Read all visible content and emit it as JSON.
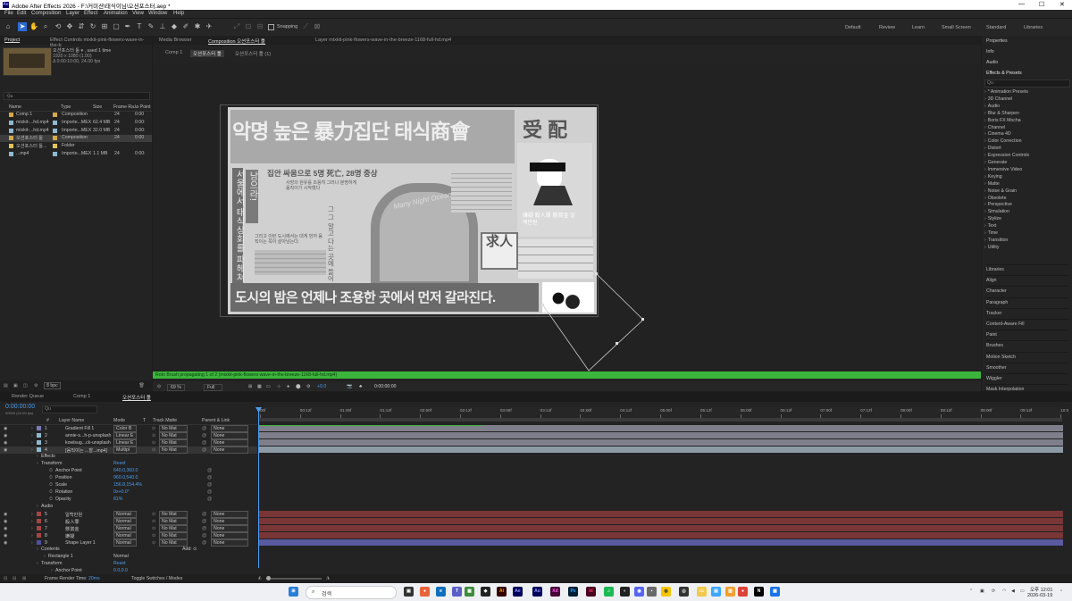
{
  "title_bar": {
    "title": "Adobe After Effects 2026 - F:\\커미션\\태식이님\\오션포스터.aep *",
    "logo_text": "Ae"
  },
  "menu": [
    "File",
    "Edit",
    "Composition",
    "Layer",
    "Effect",
    "Animation",
    "View",
    "Window",
    "Help"
  ],
  "toolbar": {
    "snapping_label": "Snapping"
  },
  "workspaces": [
    "Default",
    "Review",
    "Learn",
    "Small Screen",
    "Standard",
    "Libraries"
  ],
  "project_panel": {
    "tab_project": "Project",
    "tab_effect_controls": "Effect Controls mixkit-pink-flowers-wave-in-the-b",
    "item_name": "오션포스터 툴 ▾ , used 1 time",
    "item_dims": "1920 x 1080 (1.00)",
    "item_dur": "Δ 0:00:10:00, 24.00 fps",
    "search_placeholder": "Ⓠ▸",
    "columns": [
      "Name",
      "Type",
      "Size",
      "Frame Ra...",
      "In Point"
    ],
    "rows": [
      {
        "name": "Comp 1",
        "type": "Composition",
        "size": "",
        "fps": "24",
        "in": "0:00",
        "color": "#d4a94a"
      },
      {
        "name": "mixkit-...hd.mp4",
        "type": "Importe...MEX",
        "size": "62.4 MB",
        "fps": "24",
        "in": "0:00:",
        "color": "#8fb8d0"
      },
      {
        "name": "mixkit-...hd.mp4",
        "type": "Importe...MEX",
        "size": "32.0 MB",
        "fps": "24",
        "in": "0:00:",
        "color": "#8fb8d0"
      },
      {
        "name": "오션포스터 툴",
        "type": "Composition",
        "size": "",
        "fps": "24",
        "in": "0:00",
        "color": "#d4a94a"
      },
      {
        "name": "오션포스터 툴...",
        "type": "Folder",
        "size": "",
        "fps": "",
        "in": "",
        "color": "#e2c35a"
      },
      {
        "name": "...mp4",
        "type": "Importe...MEX",
        "size": "1.1 MB",
        "fps": "24",
        "in": "0:00:",
        "color": "#8fb8d0"
      }
    ],
    "bpc": "8 bpc"
  },
  "viewer": {
    "tabs": [
      "Media Browser",
      "Composition 오션포스터 툴",
      "Layer mixkit-pink-flowers-wave-in-the-breeze-1168-full-hd.mp4"
    ],
    "breadcrumbs": [
      "Comp 1",
      "오션포스터 툴",
      "오션포스터 툴 (1)"
    ],
    "status": "Roto Brush propagating 1 of 2 (mixkit-pink-flowers-wave-in-the-breeze-1168-full-hd.mp4)",
    "zoom": "69 %",
    "quality": "Full",
    "exposure": "+0.0",
    "timecode": "0:00:00:00"
  },
  "poster": {
    "headline": "악명 높은 暴力집단 태식商會",
    "side_title": "受 配",
    "vertical_left": "서울에서 태식상회를 파헤쳐",
    "vertical_mid": "남으라!",
    "story_title": "집안 싸움으로 5명 死亡, 28명 중상",
    "story_sub": "사망의 원유를 조용히 그러나 분명하게 움직이기 시작했다",
    "wanted_big": "求人",
    "wanted_text": "嫌疑 殺人罪 懸賞金 일백만원",
    "col_text": "그 그 알고 다는 곳에 들어 있었다",
    "mid_text": "그리고 이런 도시에서는 대게 먼저 움직이는 쪽이 살아남는다.",
    "bottom": "도시의 밤은 언제나 조용한 곳에서 먼저 갈라진다.",
    "watermark": "Many Night Ocean"
  },
  "right_panel": {
    "top_items": [
      "Properties",
      "Info",
      "Audio",
      "Effects & Presets"
    ],
    "search": "Qu",
    "effects": [
      "* Animation Presets",
      "3D Channel",
      "Audio",
      "Blur & Sharpen",
      "Boris FX Mocha",
      "Channel",
      "Cinema 4D",
      "Color Correction",
      "Distort",
      "Expression Controls",
      "Generate",
      "Immersive Video",
      "Keying",
      "Matte",
      "Noise & Grain",
      "Obsolete",
      "Perspective",
      "Simulation",
      "Stylize",
      "Text",
      "Time",
      "Transition",
      "Utility"
    ],
    "bottom_items": [
      "Libraries",
      "Align",
      "Character",
      "Paragraph",
      "Tracker",
      "Content-Aware Fill",
      "Paint",
      "Brushes",
      "Motion Sketch",
      "Smoother",
      "Wiggler",
      "Mask Interpolation"
    ]
  },
  "timeline": {
    "tabs": [
      "Render Queue",
      "Comp 1",
      "오션포스터 툴"
    ],
    "timecode": "0:00:00:00",
    "fps_text": "00000 (24.00 fps)",
    "search": "Qu",
    "columns": [
      "#",
      "Layer Name",
      "Mode",
      "T",
      "Track Matte",
      "Parent & Link"
    ],
    "ruler": [
      "00f",
      "00:12f",
      "01:00f",
      "01:12f",
      "02:00f",
      "02:12f",
      "03:00f",
      "03:12f",
      "04:00f",
      "04:12f",
      "05:00f",
      "05:12f",
      "06:00f",
      "06:12f",
      "07:00f",
      "07:12f",
      "08:00f",
      "08:12f",
      "09:00f",
      "09:12f",
      "10:0"
    ],
    "layers_top": [
      {
        "num": "1",
        "name": "Gradient Fill 1",
        "mode": "Color B",
        "matte": "No Mat",
        "parent": "None",
        "color": "#7a7ab8"
      },
      {
        "num": "2",
        "name": "annie-s...h-p-unsplash",
        "mode": "Linear E",
        "matte": "No Mat",
        "parent": "None",
        "color": "#8fb8d0"
      },
      {
        "num": "3",
        "name": "kowlsug...ck-unsplash",
        "mode": "Linear E",
        "matte": "No Mat",
        "parent": "None",
        "color": "#8fb8d0"
      },
      {
        "num": "4",
        "name": "[움직이는 ...할...mp4]",
        "mode": "Multipl",
        "matte": "No Mat",
        "parent": "None",
        "color": "#8fb8d0"
      }
    ],
    "props": {
      "effects": "Effects",
      "transform": "Transform",
      "reset": "Reset",
      "anchor_label": "Anchor Point",
      "anchor_val": "640.0,360.0",
      "position_label": "Position",
      "position_val": "960.0,540.0",
      "scale_label": "Scale",
      "scale_val": "156.8,154.4%",
      "rotation_label": "Rotation",
      "rotation_val": "0x+0.0°",
      "opacity_label": "Opacity",
      "opacity_val": "81%",
      "audio": "Audio"
    },
    "layers_bottom": [
      {
        "num": "5",
        "name": "일백만원",
        "mode": "Normal",
        "matte": "No Mat",
        "parent": "None"
      },
      {
        "num": "6",
        "name": "殺人罪",
        "mode": "Normal",
        "matte": "No Mat",
        "parent": "None"
      },
      {
        "num": "7",
        "name": "懸賞金",
        "mode": "Normal",
        "matte": "No Mat",
        "parent": "None"
      },
      {
        "num": "8",
        "name": "嫌疑",
        "mode": "Normal",
        "matte": "No Mat",
        "parent": "None"
      },
      {
        "num": "9",
        "name": "Shape Layer 1",
        "mode": "Normal",
        "matte": "No Mat",
        "parent": "None"
      }
    ],
    "shape_props": {
      "contents": "Contents",
      "add": "Add: ⊙",
      "rect": "Rectangle 1",
      "rect_mode": "Normal",
      "transform": "Transform",
      "reset": "Reset",
      "anchor": "Anchor Point",
      "anchor_val": "0.0,0.0"
    },
    "footer_render": "Frame Render Time:",
    "footer_ms": "20ms",
    "footer_toggle": "Toggle Switches / Modes"
  },
  "taskbar": {
    "search": "검색",
    "time": "오후 12:01",
    "date": "2026-03-19"
  }
}
